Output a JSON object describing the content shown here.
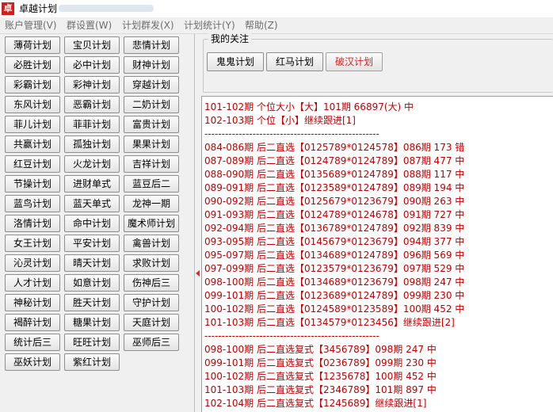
{
  "window": {
    "app_icon_text": "卓",
    "title": "卓越计划"
  },
  "menu": [
    "账户管理(V)",
    "群设置(W)",
    "计划群发(X)",
    "计划统计(Y)",
    "帮助(Z)"
  ],
  "plans": [
    "薄荷计划",
    "宝贝计划",
    "悲情计划",
    "必胜计划",
    "必中计划",
    "财神计划",
    "彩霸计划",
    "彩神计划",
    "穿越计划",
    "东风计划",
    "恶霸计划",
    "二奶计划",
    "菲儿计划",
    "菲菲计划",
    "富贵计划",
    "共赢计划",
    "孤独计划",
    "果果计划",
    "红豆计划",
    "火龙计划",
    "吉祥计划",
    "节操计划",
    "进财单式",
    "蓝豆后二",
    "蓝鸟计划",
    "蓝天单式",
    "龙神一期",
    "洛情计划",
    "命中计划",
    "魔术师计划",
    "女王计划",
    "平安计划",
    "禽兽计划",
    "沁灵计划",
    "晴天计划",
    "求败计划",
    "人才计划",
    "如意计划",
    "伤神后三",
    "神秘计划",
    "胜天计划",
    "守护计划",
    "褐醉计划",
    "糖果计划",
    "天庭计划",
    "统计后三",
    "旺旺计划",
    "巫师后三",
    "巫妖计划",
    "紫红计划"
  ],
  "favorites": {
    "label": "我的关注",
    "items": [
      "鬼鬼计划",
      "红马计划",
      "破汉计划"
    ]
  },
  "log_lines": [
    "101-102期 个位大小【大】101期 66897(大) 中",
    "102-103期 个位【小】继续跟进[1]",
    "---------------------------------------------------",
    "084-086期 后二直选【0125789*0124578】086期 173 错",
    "087-089期 后二直选【0124789*0124789】087期 477 中",
    "088-090期 后二直选【0135689*0124789】088期 117 中",
    "089-091期 后二直选【0123589*0124789】089期 194 中",
    "090-092期 后二直选【0125679*0123679】090期 263 中",
    "091-093期 后二直选【0124789*0124678】091期 727 中",
    "092-094期 后二直选【0136789*0124789】092期 839 中",
    "093-095期 后二直选【0145679*0123679】094期 377 中",
    "095-097期 后二直选【0134689*0124789】096期 569 中",
    "097-099期 后二直选【0123579*0123679】097期 529 中",
    "098-100期 后二直选【0134689*0123679】098期 247 中",
    "099-101期 后二直选【0123689*0124789】099期 230 中",
    "100-102期 后二直选【0124589*0123589】100期 452 中",
    "101-103期 后二直选【0134579*0123456】继续跟进[2]",
    "---------------------------------------------------",
    "098-100期 后二直选复式【3456789】098期 247 中",
    "099-101期 后二直选复式【0236789】099期 230 中",
    "100-102期 后二直选复式【1235678】100期 452 中",
    "101-103期 后二直选复式【2346789】101期 897 中",
    "102-104期 后二直选复式【1245689】继续跟进[1]"
  ],
  "colors": {
    "log_text": "#c00000",
    "highlight_button_text": "#d62020"
  }
}
